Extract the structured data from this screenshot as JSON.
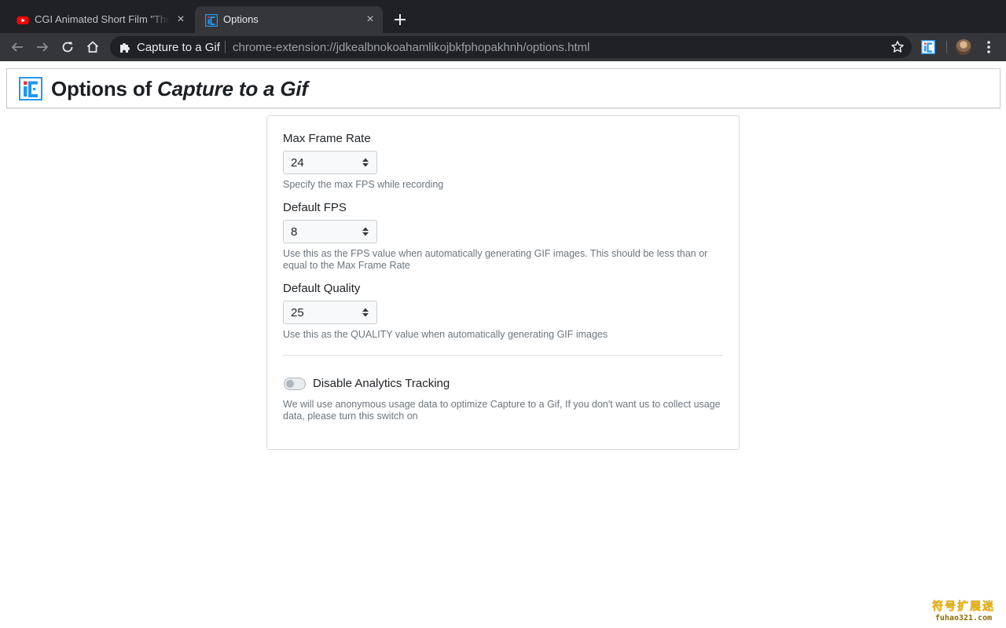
{
  "browser": {
    "tabs": [
      {
        "title": "CGI Animated Short Film \"The Gift\"",
        "icon": "youtube-icon",
        "active": false
      },
      {
        "title": "Options",
        "icon": "capture-gif-icon",
        "active": true
      }
    ],
    "close_glyph": "×",
    "omnibox": {
      "site_label": "Capture to a Gif",
      "url": "chrome-extension://jdkealbnokoahamlikojbkfphopakhnh/options.html"
    }
  },
  "page": {
    "header": {
      "title_prefix": "Options of",
      "title_ext": "Capture to a Gif"
    },
    "fields": [
      {
        "label": "Max Frame Rate",
        "value": "24",
        "help": "Specify the max FPS while recording"
      },
      {
        "label": "Default FPS",
        "value": "8",
        "help": "Use this as the FPS value when automatically generating GIF images. This should be less than or equal to the Max Frame Rate"
      },
      {
        "label": "Default Quality",
        "value": "25",
        "help": "Use this as the QUALITY value when automatically generating GIF images"
      }
    ],
    "analytics": {
      "label": "Disable Analytics Tracking",
      "enabled": false,
      "help": "We will use anonymous usage data to optimize Capture to a Gif, If you don't want us to collect usage data, please turn this switch on"
    }
  },
  "watermark": {
    "line1": "符号扩展迷",
    "line2": "fuhao321.com"
  },
  "colors": {
    "chrome_dark": "#202124",
    "chrome_toolbar": "#35363a",
    "logo_blue": "#2196f3",
    "logo_red": "#e53935"
  }
}
